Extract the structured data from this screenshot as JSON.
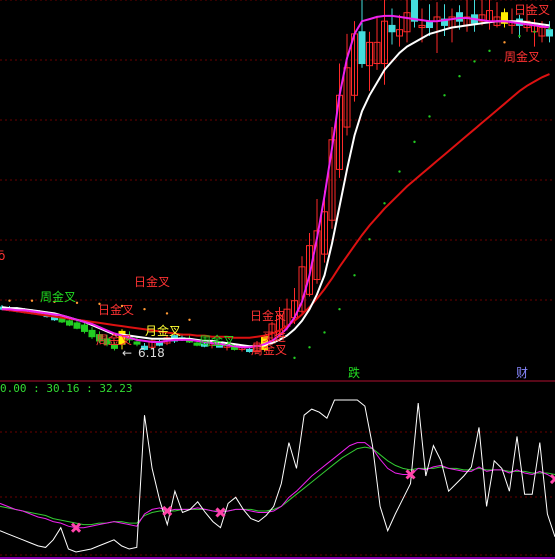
{
  "colors": {
    "background": "#000000",
    "grid": "#6a0000",
    "separator": "#b01030",
    "up_candle": "#ff2a2a",
    "down_cyan": "#44dddd",
    "down_green": "#22cc22",
    "signal_yellow": "#ffee00",
    "ma_white": "#ffffff",
    "ma_magenta": "#ee22ee",
    "ma_red": "#dd1111",
    "dots_green": "#22cc22",
    "dots_orange": "#ff9933",
    "label_red": "#ff3333",
    "label_yellow": "#ffff33",
    "label_green": "#22dd22",
    "label_white": "#dddddd",
    "label_blue": "#8888ff",
    "ind_white": "#ffffff",
    "ind_magenta": "#ee22ee",
    "ind_green": "#33cc33",
    "cross_pink": "#ff44aa",
    "ind_text_pink": "#ee22ee",
    "ind_text_yellow": "#dddd22",
    "ind_text_green": "#33dd33"
  },
  "chart_data": [
    {
      "type": "candlestick",
      "candles": [
        {
          "o": 270,
          "h": 272,
          "l": 267,
          "c": 268,
          "k": "d"
        },
        {
          "o": 269,
          "h": 271,
          "l": 266,
          "c": 267,
          "k": "d"
        },
        {
          "o": 268,
          "h": 270,
          "l": 265,
          "c": 266,
          "k": "d"
        },
        {
          "o": 267,
          "h": 269,
          "l": 264,
          "c": 265,
          "k": "d"
        },
        {
          "o": 266,
          "h": 268,
          "l": 263,
          "c": 264,
          "k": "d"
        },
        {
          "o": 265,
          "h": 267,
          "l": 262,
          "c": 263,
          "k": "d"
        },
        {
          "o": 264,
          "h": 266,
          "l": 260,
          "c": 261,
          "k": "d"
        },
        {
          "o": 262,
          "h": 264,
          "l": 257,
          "c": 258,
          "k": "d"
        },
        {
          "o": 259,
          "h": 261,
          "l": 255,
          "c": 256,
          "k": "g"
        },
        {
          "o": 257,
          "h": 259,
          "l": 252,
          "c": 253,
          "k": "g"
        },
        {
          "o": 255,
          "h": 258,
          "l": 249,
          "c": 250,
          "k": "g"
        },
        {
          "o": 253,
          "h": 256,
          "l": 245,
          "c": 247,
          "k": "g"
        },
        {
          "o": 248,
          "h": 251,
          "l": 240,
          "c": 242,
          "k": "g"
        },
        {
          "o": 244,
          "h": 247,
          "l": 236,
          "c": 238,
          "k": "g"
        },
        {
          "o": 240,
          "h": 244,
          "l": 233,
          "c": 235,
          "k": "g"
        },
        {
          "o": 234,
          "h": 237,
          "l": 229,
          "c": 231,
          "k": "g"
        },
        {
          "o": 235,
          "h": 249,
          "l": 230,
          "c": 247,
          "k": "y"
        },
        {
          "o": 241,
          "h": 247,
          "l": 236,
          "c": 239,
          "k": "g"
        },
        {
          "o": 237,
          "h": 242,
          "l": 233,
          "c": 235,
          "k": "g"
        },
        {
          "o": 233,
          "h": 236,
          "l": 229,
          "c": 230,
          "k": "d"
        },
        {
          "o": 232,
          "h": 240,
          "l": 230,
          "c": 238,
          "k": "u"
        },
        {
          "o": 236,
          "h": 239,
          "l": 233,
          "c": 234,
          "k": "d"
        },
        {
          "o": 236,
          "h": 243,
          "l": 234,
          "c": 241,
          "k": "u"
        },
        {
          "o": 238,
          "h": 244,
          "l": 236,
          "c": 243,
          "k": "d"
        },
        {
          "o": 241,
          "h": 245,
          "l": 238,
          "c": 240,
          "k": "d"
        },
        {
          "o": 240,
          "h": 244,
          "l": 236,
          "c": 237,
          "k": "g"
        },
        {
          "o": 236,
          "h": 240,
          "l": 233,
          "c": 234,
          "k": "g"
        },
        {
          "o": 235,
          "h": 239,
          "l": 232,
          "c": 233,
          "k": "d"
        },
        {
          "o": 234,
          "h": 238,
          "l": 231,
          "c": 236,
          "k": "u"
        },
        {
          "o": 234,
          "h": 237,
          "l": 232,
          "c": 233,
          "k": "d"
        },
        {
          "o": 232,
          "h": 236,
          "l": 229,
          "c": 234,
          "k": "u"
        },
        {
          "o": 232,
          "h": 235,
          "l": 229,
          "c": 230,
          "k": "g"
        },
        {
          "o": 230,
          "h": 234,
          "l": 228,
          "c": 232,
          "k": "u"
        },
        {
          "o": 230,
          "h": 233,
          "l": 227,
          "c": 228,
          "k": "d"
        },
        {
          "o": 228,
          "h": 238,
          "l": 226,
          "c": 236,
          "k": "u"
        },
        {
          "o": 230,
          "h": 244,
          "l": 228,
          "c": 242,
          "k": "y"
        },
        {
          "o": 236,
          "h": 256,
          "l": 234,
          "c": 254,
          "k": "u"
        },
        {
          "o": 244,
          "h": 270,
          "l": 242,
          "c": 262,
          "k": "u"
        },
        {
          "o": 252,
          "h": 278,
          "l": 248,
          "c": 268,
          "k": "u"
        },
        {
          "o": 260,
          "h": 288,
          "l": 254,
          "c": 276,
          "k": "u"
        },
        {
          "o": 266,
          "h": 318,
          "l": 262,
          "c": 308,
          "k": "u"
        },
        {
          "o": 282,
          "h": 340,
          "l": 280,
          "c": 328,
          "k": "u"
        },
        {
          "o": 296,
          "h": 372,
          "l": 292,
          "c": 342,
          "k": "u"
        },
        {
          "o": 320,
          "h": 380,
          "l": 312,
          "c": 360,
          "k": "u"
        },
        {
          "o": 352,
          "h": 440,
          "l": 344,
          "c": 428,
          "k": "u"
        },
        {
          "o": 400,
          "h": 500,
          "l": 392,
          "c": 470,
          "k": "u"
        },
        {
          "o": 440,
          "h": 528,
          "l": 432,
          "c": 496,
          "k": "u"
        },
        {
          "o": 470,
          "h": 540,
          "l": 464,
          "c": 528,
          "k": "u"
        },
        {
          "o": 530,
          "h": 575,
          "l": 496,
          "c": 500,
          "k": "d"
        },
        {
          "o": 498,
          "h": 530,
          "l": 474,
          "c": 520,
          "k": "u"
        },
        {
          "o": 520,
          "h": 545,
          "l": 494,
          "c": 500,
          "k": "u"
        },
        {
          "o": 500,
          "h": 560,
          "l": 480,
          "c": 540,
          "k": "u"
        },
        {
          "o": 536,
          "h": 552,
          "l": 518,
          "c": 530,
          "k": "d"
        },
        {
          "o": 532,
          "h": 546,
          "l": 516,
          "c": 526,
          "k": "u"
        },
        {
          "o": 530,
          "h": 575,
          "l": 520,
          "c": 548,
          "k": "u"
        },
        {
          "o": 560,
          "h": 580,
          "l": 534,
          "c": 540,
          "k": "d"
        },
        {
          "o": 536,
          "h": 552,
          "l": 520,
          "c": 534,
          "k": "u"
        },
        {
          "o": 534,
          "h": 556,
          "l": 526,
          "c": 540,
          "k": "d"
        },
        {
          "o": 540,
          "h": 558,
          "l": 510,
          "c": 544,
          "k": "u"
        },
        {
          "o": 542,
          "h": 556,
          "l": 526,
          "c": 536,
          "k": "d"
        },
        {
          "o": 534,
          "h": 552,
          "l": 520,
          "c": 544,
          "k": "u"
        },
        {
          "o": 540,
          "h": 555,
          "l": 532,
          "c": 548,
          "k": "d"
        },
        {
          "o": 544,
          "h": 560,
          "l": 530,
          "c": 536,
          "k": "u"
        },
        {
          "o": 538,
          "h": 560,
          "l": 530,
          "c": 546,
          "k": "d"
        },
        {
          "o": 546,
          "h": 566,
          "l": 536,
          "c": 540,
          "k": "u"
        },
        {
          "o": 540,
          "h": 565,
          "l": 532,
          "c": 550,
          "k": "u"
        },
        {
          "o": 544,
          "h": 558,
          "l": 534,
          "c": 536,
          "k": "u"
        },
        {
          "o": 538,
          "h": 552,
          "l": 534,
          "c": 548,
          "k": "y"
        },
        {
          "o": 540,
          "h": 552,
          "l": 528,
          "c": 536,
          "k": "u"
        },
        {
          "o": 536,
          "h": 546,
          "l": 524,
          "c": 542,
          "k": "d"
        },
        {
          "o": 540,
          "h": 556,
          "l": 530,
          "c": 534,
          "k": "u"
        },
        {
          "o": 530,
          "h": 542,
          "l": 516,
          "c": 536,
          "k": "u"
        },
        {
          "o": 534,
          "h": 540,
          "l": 520,
          "c": 526,
          "k": "u"
        },
        {
          "o": 526,
          "h": 540,
          "l": 520,
          "c": 532,
          "k": "d"
        }
      ],
      "ma_white": [
        270,
        269,
        269,
        268,
        267,
        266,
        265,
        264,
        262,
        260,
        258,
        256,
        253,
        250,
        247,
        244,
        244,
        243,
        242,
        241,
        240,
        240,
        240,
        240,
        240,
        240,
        239,
        238,
        238,
        237,
        236,
        235,
        234,
        233,
        233,
        234,
        236,
        239,
        243,
        249,
        257,
        268,
        282,
        300,
        330,
        365,
        400,
        432,
        455,
        470,
        482,
        494,
        502,
        510,
        516,
        520,
        524,
        528,
        530,
        532,
        534,
        535,
        536,
        537,
        538,
        539,
        540,
        540,
        540,
        540,
        539,
        538,
        537,
        536
      ],
      "ma_magenta": [
        268,
        268,
        267,
        267,
        266,
        265,
        264,
        263,
        262,
        260,
        258,
        256,
        254,
        251,
        248,
        245,
        243,
        241,
        239,
        238,
        237,
        237,
        238,
        239,
        239,
        239,
        238,
        237,
        236,
        235,
        234,
        233,
        232,
        232,
        233,
        235,
        238,
        243,
        250,
        260,
        275,
        300,
        335,
        375,
        420,
        470,
        505,
        528,
        540,
        542,
        544,
        545,
        545,
        544,
        543,
        542,
        541,
        540,
        540,
        541,
        542,
        543,
        543,
        542,
        541,
        540,
        540,
        540,
        539,
        538,
        537,
        536,
        535,
        534
      ],
      "ma_red": [
        268,
        267,
        266,
        265,
        264,
        263,
        262,
        261,
        260,
        259,
        258,
        257,
        256,
        255,
        254,
        253,
        252,
        251,
        250,
        249,
        248,
        247,
        246,
        245,
        244,
        244,
        243,
        243,
        242,
        242,
        242,
        241,
        241,
        241,
        242,
        243,
        245,
        248,
        252,
        257,
        263,
        270,
        278,
        287,
        297,
        308,
        318,
        328,
        338,
        347,
        355,
        363,
        370,
        377,
        384,
        390,
        396,
        402,
        408,
        414,
        420,
        426,
        432,
        438,
        444,
        450,
        456,
        462,
        468,
        474,
        479,
        483,
        487,
        490
      ],
      "dots": [
        {
          "i": 1,
          "v": 276,
          "c": "o"
        },
        {
          "i": 4,
          "v": 276,
          "c": "o"
        },
        {
          "i": 7,
          "v": 275,
          "c": "o"
        },
        {
          "i": 10,
          "v": 274,
          "c": "o"
        },
        {
          "i": 13,
          "v": 273,
          "c": "o"
        },
        {
          "i": 16,
          "v": 271,
          "c": "o"
        },
        {
          "i": 19,
          "v": 268,
          "c": "o"
        },
        {
          "i": 22,
          "v": 264,
          "c": "o"
        },
        {
          "i": 25,
          "v": 258,
          "c": "o"
        },
        {
          "i": 39,
          "v": 222,
          "c": "g"
        },
        {
          "i": 41,
          "v": 232,
          "c": "g"
        },
        {
          "i": 43,
          "v": 246,
          "c": "g"
        },
        {
          "i": 45,
          "v": 268,
          "c": "g"
        },
        {
          "i": 47,
          "v": 300,
          "c": "g"
        },
        {
          "i": 49,
          "v": 334,
          "c": "g"
        },
        {
          "i": 51,
          "v": 368,
          "c": "g"
        },
        {
          "i": 53,
          "v": 398,
          "c": "g"
        },
        {
          "i": 55,
          "v": 426,
          "c": "g"
        },
        {
          "i": 57,
          "v": 450,
          "c": "g"
        },
        {
          "i": 59,
          "v": 470,
          "c": "g"
        },
        {
          "i": 61,
          "v": 488,
          "c": "g"
        },
        {
          "i": 63,
          "v": 502,
          "c": "g"
        },
        {
          "i": 65,
          "v": 512,
          "c": "g"
        },
        {
          "i": 67,
          "v": 520,
          "c": "o"
        },
        {
          "i": 69,
          "v": 526,
          "c": "g"
        },
        {
          "i": 71,
          "v": 530,
          "c": "g"
        },
        {
          "i": 73,
          "v": 533,
          "c": "g"
        }
      ]
    },
    {
      "type": "line",
      "title": "0.00 : 30.16 : 32.23",
      "white": [
        14,
        12,
        10,
        8,
        6,
        4,
        3,
        8,
        16,
        2,
        0,
        1,
        2,
        4,
        6,
        8,
        4,
        2,
        3,
        90,
        55,
        34,
        18,
        40,
        26,
        28,
        33,
        26,
        20,
        16,
        32,
        36,
        28,
        22,
        20,
        24,
        30,
        45,
        72,
        55,
        90,
        94,
        92,
        88,
        100,
        100,
        100,
        100,
        96,
        70,
        30,
        14,
        25,
        35,
        45,
        98,
        50,
        70,
        60,
        40,
        45,
        50,
        56,
        82,
        30,
        60,
        55,
        40,
        76,
        38,
        38,
        72,
        25,
        10
      ],
      "magenta": [
        32,
        30,
        28,
        27,
        25,
        23,
        22,
        20,
        19,
        17,
        16,
        16,
        17,
        18,
        19,
        20,
        19,
        18,
        17,
        25,
        28,
        29,
        27,
        28,
        28,
        28,
        29,
        28,
        27,
        26,
        27,
        28,
        28,
        27,
        26,
        26,
        27,
        30,
        36,
        40,
        45,
        50,
        54,
        58,
        62,
        66,
        70,
        72,
        72,
        68,
        61,
        55,
        52,
        51,
        51,
        55,
        54,
        56,
        57,
        55,
        54,
        53,
        53,
        56,
        53,
        54,
        54,
        52,
        54,
        52,
        51,
        53,
        51,
        48
      ],
      "green": [
        30,
        29,
        28,
        27,
        26,
        25,
        24,
        22,
        21,
        20,
        19,
        18,
        18,
        19,
        19,
        20,
        20,
        19,
        19,
        24,
        26,
        27,
        27,
        27,
        28,
        28,
        28,
        28,
        27,
        27,
        27,
        28,
        28,
        28,
        27,
        27,
        28,
        30,
        34,
        38,
        42,
        46,
        50,
        54,
        58,
        62,
        65,
        68,
        69,
        68,
        64,
        60,
        57,
        55,
        54,
        55,
        55,
        55,
        56,
        55,
        55,
        54,
        54,
        55,
        54,
        54,
        54,
        53,
        53,
        53,
        52,
        52,
        52,
        51
      ],
      "crosses": [
        10,
        22,
        29,
        54,
        123
      ],
      "ylim": [
        0,
        100
      ]
    }
  ],
  "labels": {
    "ri_jincha_top": "日金叉",
    "ri_jincha_mid": "日金叉",
    "ri_jincha_right": "日金叉",
    "zhou_jincha_left": "周金叉",
    "zhou_jincha_mid": "周金叉",
    "zhou_jincha_right": "周金叉",
    "zhou_jincha_last": "周金叉",
    "yue_jincha": "月金叉",
    "mai_jin": "买进",
    "price_low": "6.18",
    "die": "跌",
    "cai": "财",
    "edge_mark": "ō"
  }
}
